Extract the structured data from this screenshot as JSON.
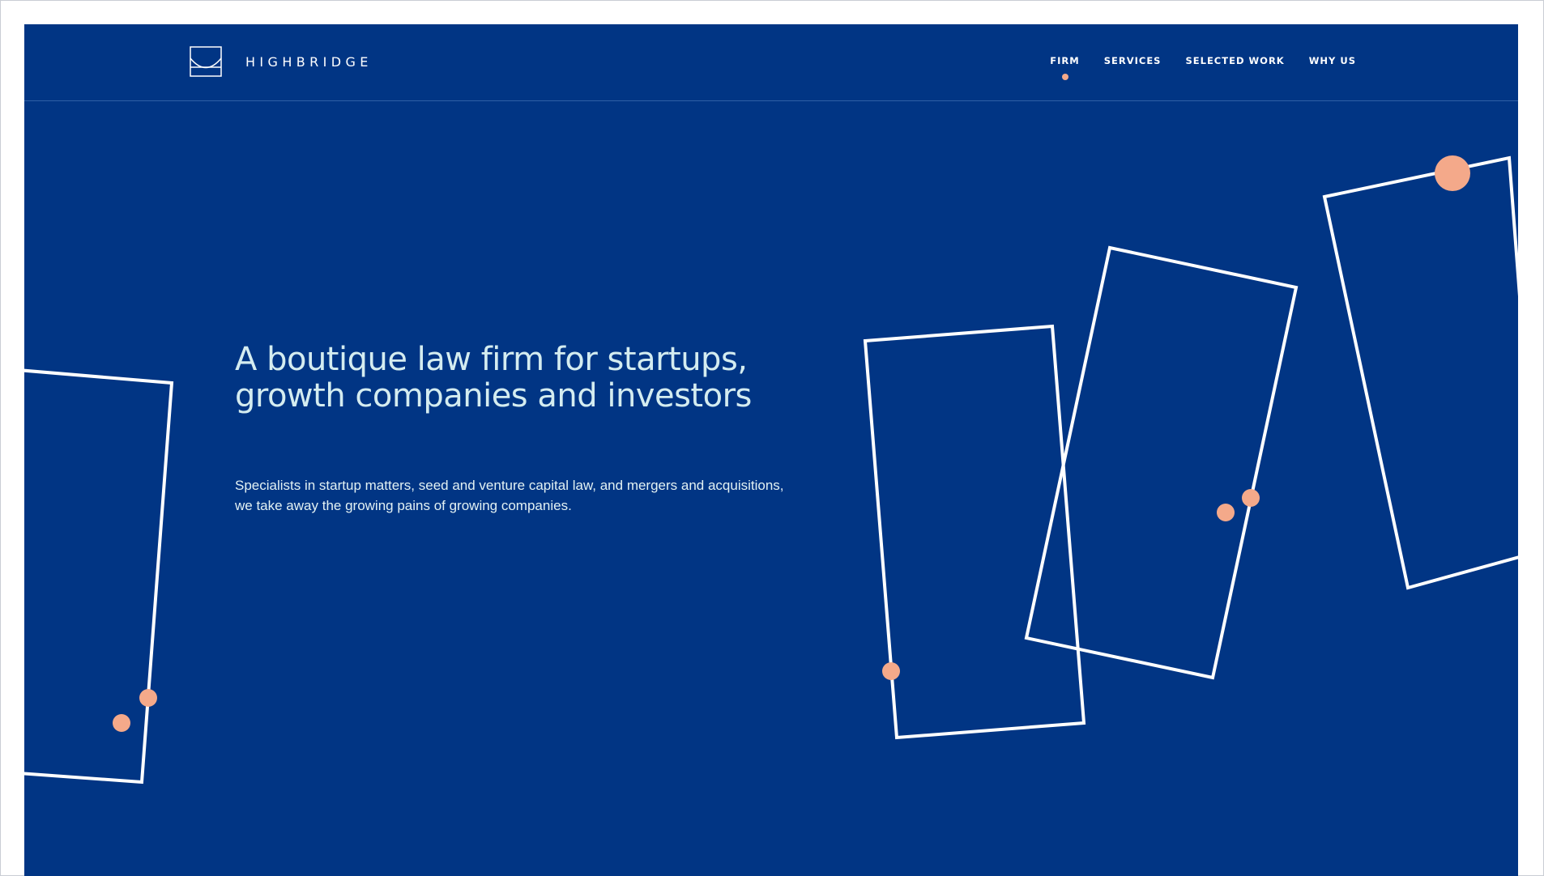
{
  "brand": {
    "name": "HIGHBRIDGE",
    "accent_color": "#f4a98a",
    "background_color": "#013584",
    "logo_icon": "bridge-arch-logo-icon"
  },
  "nav": {
    "items": [
      {
        "label": "FIRM",
        "active": true
      },
      {
        "label": "SERVICES",
        "active": false
      },
      {
        "label": "SELECTED WORK",
        "active": false
      },
      {
        "label": "WHY US",
        "active": false
      }
    ]
  },
  "hero": {
    "title": "A boutique law firm for startups, growth companies and investors",
    "subtitle": "Specialists in startup matters, seed and venture capital law, and mergers and acquisitions, we take away the growing pains of growing companies."
  }
}
